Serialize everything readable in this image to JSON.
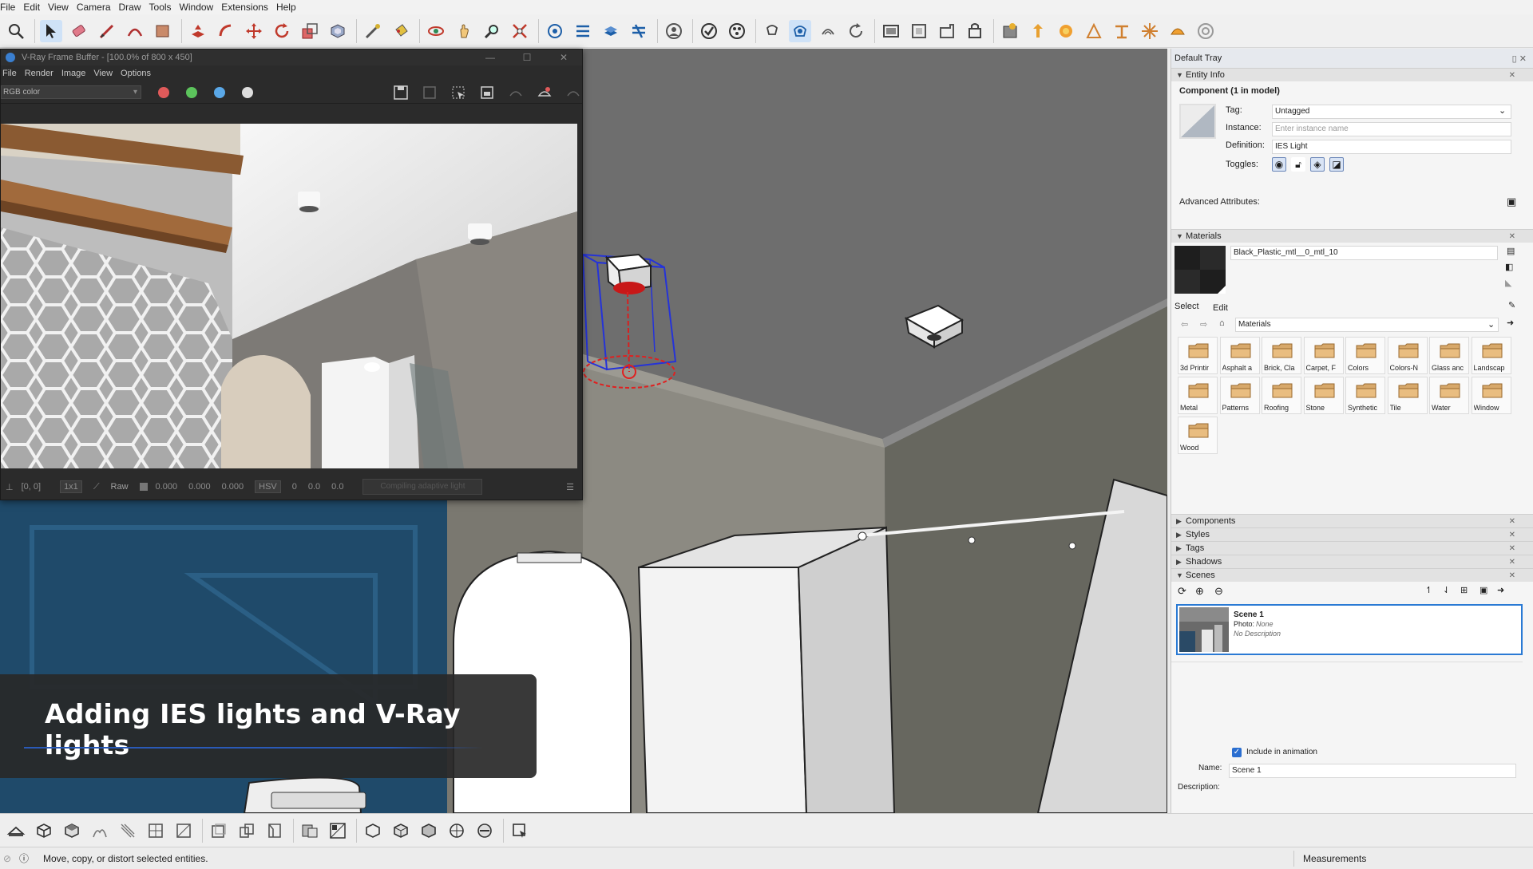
{
  "menu": [
    "File",
    "Edit",
    "View",
    "Camera",
    "Draw",
    "Tools",
    "Window",
    "Extensions",
    "Help"
  ],
  "toolbar_icons": [
    "search-icon",
    "select-icon",
    "eraser-icon",
    "pencil-icon",
    "arc-icon",
    "shape-icon",
    "push-pull-icon",
    "follow-me-icon",
    "move-icon",
    "rotate-icon",
    "scale-icon",
    "offset-icon",
    "tape-measure-icon",
    "paint-bucket-icon",
    "orbit-icon",
    "pan-icon",
    "zoom-icon",
    "zoom-extents-icon",
    "vray-asset-icon",
    "vray-render-icon",
    "vray-interactive-icon",
    "vray-batch-icon",
    "vray-user-icon",
    "vray-check-icon",
    "vray-material-icon",
    "vray-light-icon",
    "vray-sphere-icon",
    "vray-spot-icon",
    "vray-rect-icon",
    "vray-ies-icon",
    "vray-omni-icon",
    "vray-dome-icon",
    "vray-mesh-icon",
    "vray-proxy-icon",
    "vray-clipper-icon",
    "vray-fur-icon",
    "vray-scatter-icon",
    "vray-decal-icon",
    "vray-lamp-icon",
    "vray-sun-icon",
    "vray-sky-icon",
    "vray-bulb-icon",
    "vray-settings-icon"
  ],
  "vfb": {
    "title": "V-Ray Frame Buffer - [100.0% of 800 x 450]",
    "menu": [
      "File",
      "Render",
      "Image",
      "View",
      "Options"
    ],
    "channel": "RGB color",
    "status": {
      "coords": "[0, 0]",
      "ratio": "1x1",
      "raw_label": "Raw",
      "v1": "0.000",
      "v2": "0.000",
      "v3": "0.000",
      "mode": "HSV",
      "h": "0",
      "s": "0.0",
      "v": "0.0",
      "progress": "Compiling adaptive light"
    }
  },
  "caption": "Adding IES lights and V-Ray lights",
  "tray": {
    "title": "Default Tray",
    "entity_info": {
      "header": "Entity Info",
      "component_title": "Component (1 in model)",
      "tag_label": "Tag:",
      "tag_value": "Untagged",
      "instance_label": "Instance:",
      "instance_placeholder": "Enter instance name",
      "definition_label": "Definition:",
      "definition_value": "IES Light",
      "toggles_label": "Toggles:",
      "advanced_label": "Advanced Attributes:"
    },
    "materials": {
      "header": "Materials",
      "current": "Black_Plastic_mtl__0_mtl_10",
      "select_tab": "Select",
      "edit_tab": "Edit",
      "library": "Materials",
      "folders": [
        "3d Printir",
        "Asphalt a",
        "Brick, Cla",
        "Carpet, F",
        "Colors",
        "Colors-N",
        "Glass anc",
        "Landscap",
        "Metal",
        "Patterns",
        "Roofing",
        "Stone",
        "Synthetic",
        "Tile",
        "Water",
        "Window",
        "Wood"
      ]
    },
    "collapsed_sections": [
      "Components",
      "Styles",
      "Tags",
      "Shadows"
    ],
    "scenes": {
      "header": "Scenes",
      "scene_name": "Scene 1",
      "photo_label": "Photo:",
      "photo_value": "None",
      "description": "No Description",
      "include_label": "Include in animation",
      "name_label": "Name:",
      "name_value": "Scene 1",
      "description_label": "Description:"
    }
  },
  "bottom_icons": [
    "walkthrough-icon",
    "iso-view-icon",
    "top-view-icon",
    "front-view-icon",
    "right-view-icon",
    "back-view-icon",
    "left-view-icon",
    "xray-icon",
    "back-edges-icon",
    "wireframe-icon",
    "hidden-line-icon",
    "shaded-icon",
    "shaded-texture-icon",
    "monochrome-icon",
    "section-plane-icon",
    "section-cut-icon",
    "section-fill-icon",
    "display-sections-icon",
    "outliner-icon",
    "component-icon"
  ],
  "statusbar": {
    "message": "Move, copy, or distort selected entities.",
    "measurements_label": "Measurements"
  },
  "colors": {
    "accent": "#2a5ab8",
    "vfb_bg": "#2b2b2b",
    "red_dot": "#e05a5a",
    "green_dot": "#5cc45c",
    "blue_dot": "#5aa8e8"
  }
}
